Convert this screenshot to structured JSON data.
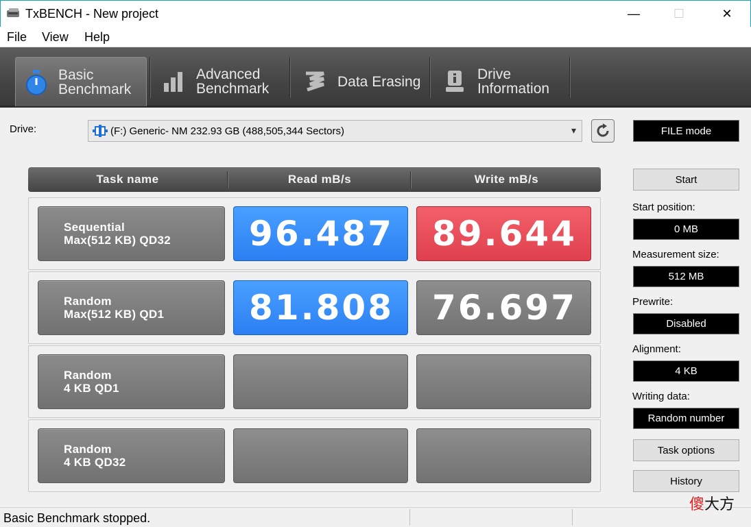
{
  "window": {
    "title": "TxBENCH - New project",
    "minimize": "—",
    "maximize": "☐",
    "close": "✕"
  },
  "menu": [
    "File",
    "View",
    "Help"
  ],
  "tabs": [
    {
      "label": "Basic\nBenchmark",
      "icon": "stopwatch-icon",
      "active": true
    },
    {
      "label": "Advanced\nBenchmark",
      "icon": "bar-chart-icon",
      "active": false
    },
    {
      "label": "Data Erasing",
      "icon": "eraser-icon",
      "active": false
    },
    {
      "label": "Drive\nInformation",
      "icon": "drive-info-icon",
      "active": false
    }
  ],
  "drive": {
    "label": "Drive:",
    "selected": "(F:) Generic- NM  232.93 GB (488,505,344 Sectors)",
    "mode": "FILE mode"
  },
  "grid": {
    "headers": [
      "Task name",
      "Read mB/s",
      "Write mB/s"
    ],
    "rows": [
      {
        "task": "Sequential\nMax(512 KB) QD32",
        "read": "96.487",
        "write": "89.644",
        "read_color": "blue",
        "write_color": "red"
      },
      {
        "task": "Random\nMax(512 KB) QD1",
        "read": "81.808",
        "write": "76.697",
        "read_color": "blue",
        "write_color": "gray"
      },
      {
        "task": "Random\n4 KB QD1",
        "read": "",
        "write": "",
        "read_color": "gray",
        "write_color": "gray"
      },
      {
        "task": "Random\n4 KB QD32",
        "read": "",
        "write": "",
        "read_color": "gray",
        "write_color": "gray"
      }
    ]
  },
  "side": {
    "start_button": "Start",
    "start_position_label": "Start position:",
    "start_position_value": "0 MB",
    "measurement_size_label": "Measurement size:",
    "measurement_size_value": "512 MB",
    "prewrite_label": "Prewrite:",
    "prewrite_value": "Disabled",
    "alignment_label": "Alignment:",
    "alignment_value": "4 KB",
    "writing_data_label": "Writing data:",
    "writing_data_value": "Random number",
    "task_options_button": "Task options",
    "history_button": "History"
  },
  "status": {
    "text": "Basic Benchmark stopped."
  },
  "watermark": {
    "char1": "傻",
    "char2": "大方"
  },
  "colors": {
    "blue": "#2b7ff2",
    "red": "#e0404e",
    "gray": "#7a7a7a",
    "accent": "#17a2b8"
  }
}
